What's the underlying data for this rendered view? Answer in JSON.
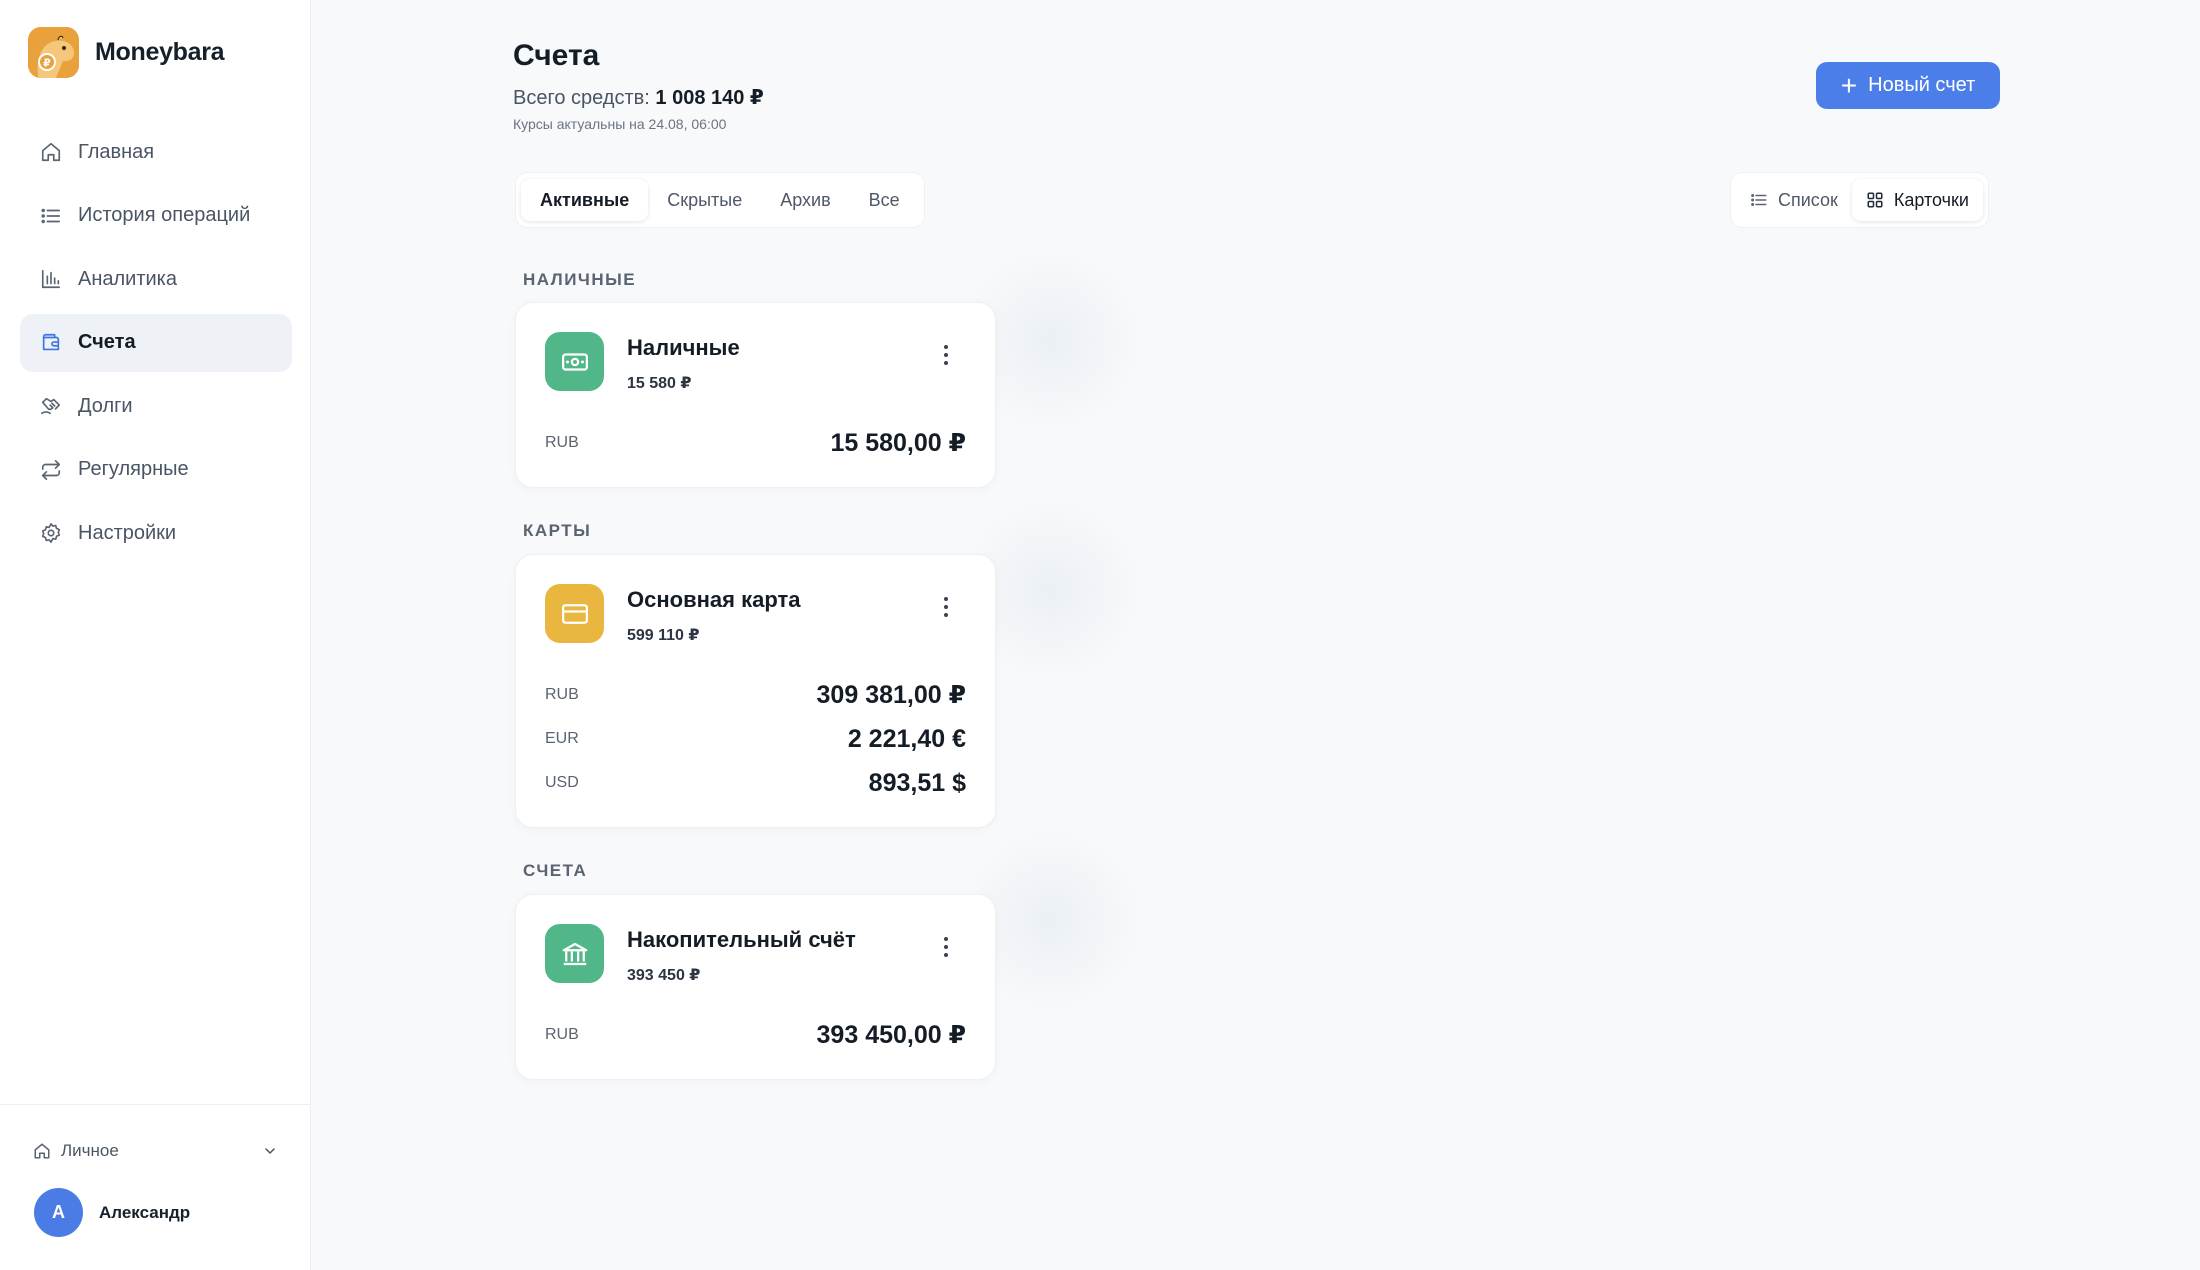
{
  "app": {
    "name": "Moneybara"
  },
  "sidebar": {
    "items": [
      {
        "label": "Главная",
        "icon": "home-icon"
      },
      {
        "label": "История операций",
        "icon": "list-icon"
      },
      {
        "label": "Аналитика",
        "icon": "bar-chart-icon"
      },
      {
        "label": "Счета",
        "icon": "wallet-icon",
        "active": true
      },
      {
        "label": "Долги",
        "icon": "handshake-icon"
      },
      {
        "label": "Регулярные",
        "icon": "repeat-icon"
      },
      {
        "label": "Настройки",
        "icon": "gear-icon"
      }
    ],
    "workspace": "Личное",
    "user": {
      "initial": "A",
      "name": "Александр"
    }
  },
  "header": {
    "title": "Счета",
    "total_label": "Всего средств:",
    "total_value": "1 008 140 ₽",
    "rates_note": "Курсы актуальны на 24.08, 06:00",
    "new_button": "Новый счет"
  },
  "filters": {
    "tabs": [
      "Активные",
      "Скрытые",
      "Архив",
      "Все"
    ],
    "active": "Активные"
  },
  "view_toggle": {
    "list": "Список",
    "cards": "Карточки",
    "active": "Карточки"
  },
  "groups": [
    {
      "label": "НАЛИЧНЫЕ",
      "accounts": [
        {
          "name": "Наличные",
          "total": "15 580 ₽",
          "icon": "cash-icon",
          "color": "#52b788",
          "balances": [
            {
              "currency": "RUB",
              "amount": "15 580,00 ₽"
            }
          ]
        }
      ]
    },
    {
      "label": "КАРТЫ",
      "accounts": [
        {
          "name": "Основная карта",
          "total": "599 110 ₽",
          "icon": "credit-card-icon",
          "color": "#e9b73f",
          "balances": [
            {
              "currency": "RUB",
              "amount": "309 381,00 ₽"
            },
            {
              "currency": "EUR",
              "amount": "2 221,40 €"
            },
            {
              "currency": "USD",
              "amount": "893,51 $"
            }
          ]
        }
      ]
    },
    {
      "label": "СЧЕТА",
      "accounts": [
        {
          "name": "Накопительный счёт",
          "total": "393 450 ₽",
          "icon": "bank-icon",
          "color": "#52b788",
          "balances": [
            {
              "currency": "RUB",
              "amount": "393 450,00 ₽"
            }
          ]
        }
      ]
    }
  ],
  "colors": {
    "accent": "#4b7ee8",
    "brand": "#e9a13b",
    "green": "#52b788",
    "yellow": "#e9b73f"
  }
}
